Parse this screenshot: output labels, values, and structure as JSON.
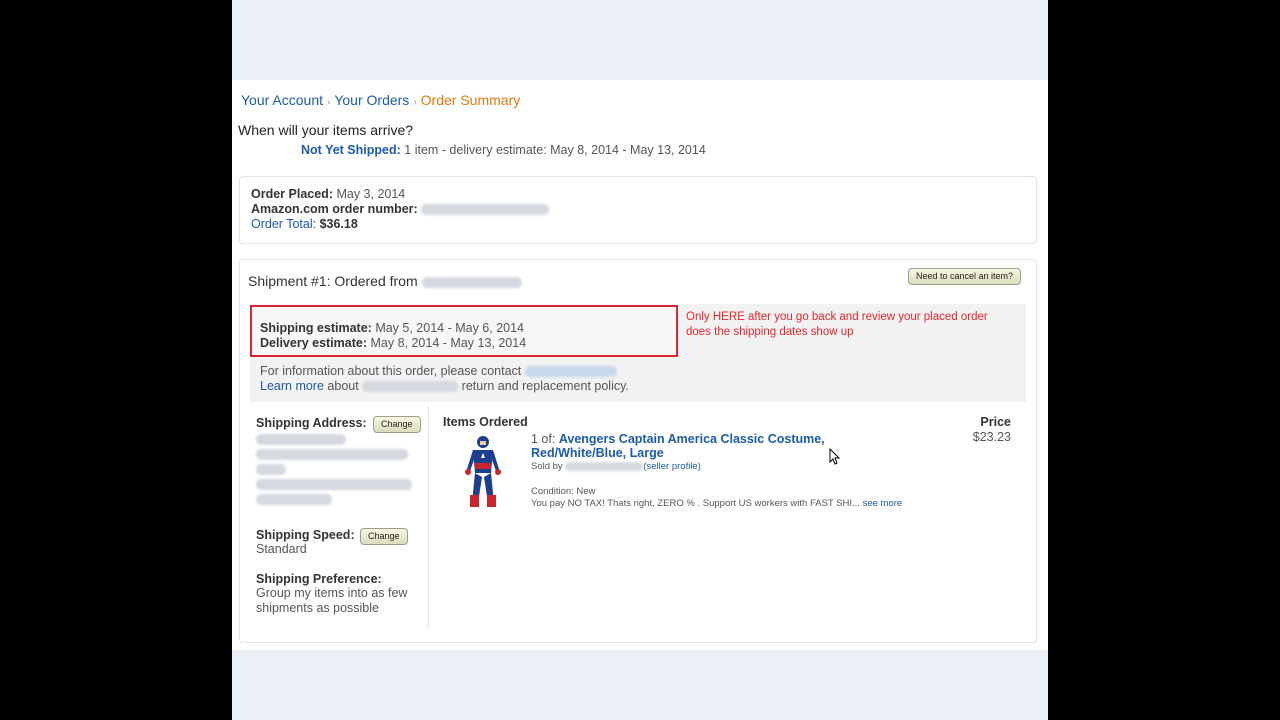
{
  "breadcrumb": [
    "Your Account",
    "Your Orders",
    "Order Summary"
  ],
  "when_text": "When will your items arrive?",
  "not_yet_shipped": {
    "label": "Not Yet Shipped:",
    "text": "1 item - delivery estimate: May 8, 2014 - May 13, 2014"
  },
  "order": {
    "placed_label": "Order Placed:",
    "placed_value": "May 3, 2014",
    "number_label": "Amazon.com order number:",
    "total_link": "Order Total:",
    "total_value": "$36.18"
  },
  "shipment": {
    "title": "Shipment #1: Ordered from",
    "cancel_button": "Need to cancel an item?",
    "shipping_estimate_label": "Shipping estimate:",
    "shipping_estimate_value": "May 5, 2014 - May 6, 2014",
    "delivery_estimate_label": "Delivery estimate:",
    "delivery_estimate_value": "May 8, 2014 - May 13, 2014",
    "annotation_line1": "Only HERE after you go back and review your placed order",
    "annotation_line2": "does the shipping dates show up",
    "info_line": "For information about this order, please contact",
    "learn_more": "Learn more",
    "about": "about",
    "policy": "return and replacement policy."
  },
  "left": {
    "address_label": "Shipping Address:",
    "change": "Change",
    "speed_label": "Shipping Speed:",
    "speed_value": "Standard",
    "pref_label": "Shipping Preference:",
    "pref_value": "Group my items into as few shipments as possible"
  },
  "items": {
    "header": "Items Ordered",
    "price_header": "Price",
    "qty": "1 of:",
    "title": "Avengers Captain America Classic Costume, Red/White/Blue, Large",
    "sold_by": "Sold by",
    "seller_profile": "(seller profile)",
    "condition": "Condition: New",
    "description": "You pay NO TAX! Thats right, ZERO % . Support US workers with FAST SHI...",
    "see_more": "see more",
    "price": "$23.23"
  },
  "colors": {
    "link": "#1c5ba8",
    "breadcrumb_current": "#e47911",
    "annotation": "#e8262c",
    "page_bg": "#ebf0f6"
  }
}
